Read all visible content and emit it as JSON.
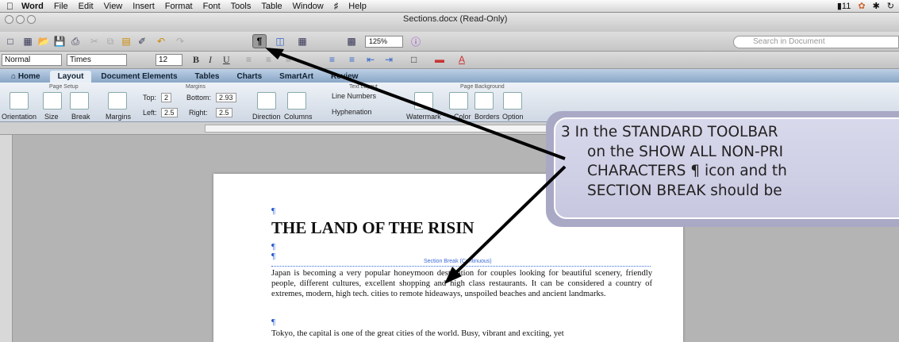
{
  "menubar": {
    "app": "Word",
    "items": [
      "File",
      "Edit",
      "View",
      "Insert",
      "Format",
      "Font",
      "Tools",
      "Table",
      "Window",
      "Help"
    ],
    "battery": "11"
  },
  "window": {
    "title": "Sections.docx (Read-Only)"
  },
  "toolbar": {
    "pilcrow": "¶",
    "zoom": "125%"
  },
  "search": {
    "placeholder": "Search in Document"
  },
  "format": {
    "style": "Normal",
    "font": "Times",
    "size": "12"
  },
  "tabs": [
    "Home",
    "Layout",
    "Document Elements",
    "Tables",
    "Charts",
    "SmartArt",
    "Review"
  ],
  "ribbon": {
    "groups": {
      "page_setup": "Page Setup",
      "margins": "Margins",
      "text_layout": "Text Layout",
      "page_background": "Page Background"
    },
    "labels": {
      "orientation": "Orientation",
      "size": "Size",
      "break": "Break",
      "margins": "Margins",
      "top": "Top:",
      "top_val": "2",
      "bottom": "Bottom:",
      "bottom_val": "2.93",
      "left": "Left:",
      "left_val": "2.5",
      "right": "Right:",
      "right_val": "2.5",
      "direction": "Direction",
      "columns": "Columns",
      "line_numbers": "Line Numbers",
      "hyphenation": "Hyphenation",
      "watermark": "Watermark",
      "color": "Color",
      "borders": "Borders",
      "options": "Option"
    }
  },
  "document": {
    "heading": "THE LAND OF THE RISIN",
    "section_break": "Section Break (Continuous)",
    "paragraph1": "Japan is becoming a very popular honeymoon destination for couples looking for beautiful scenery, friendly people, different cultures, excellent shopping and high class restaurants. It can be considered a country of extremes, modern, high tech. cities to remote hideaways, unspoiled beaches and ancient landmarks.",
    "paragraph2": "Tokyo, the capital is one of the great cities of the world. Busy, vibrant and exciting, yet",
    "pilcrow": "¶"
  },
  "callout": {
    "line1": "3  In the STANDARD TOOLBAR",
    "line2": "on the SHOW ALL NON-PRI",
    "line3": "CHARACTERS ¶ icon and th",
    "line4": "SECTION BREAK should be"
  }
}
